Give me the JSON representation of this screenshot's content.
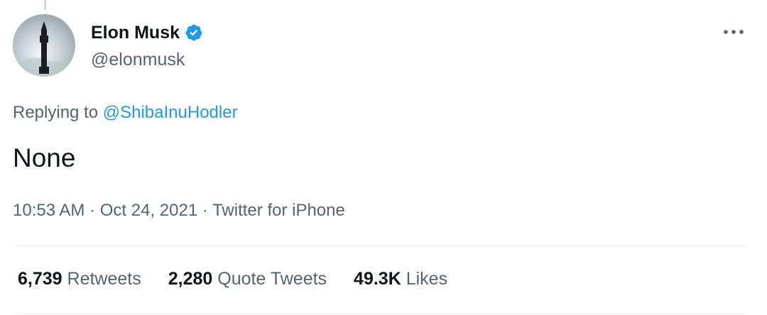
{
  "author": {
    "display_name": "Elon Musk",
    "handle": "@elonmusk",
    "verified": true,
    "verified_color": "#1d9bf0"
  },
  "reply": {
    "prefix": "Replying to",
    "mention": "@ShibaInuHodler"
  },
  "tweet": {
    "text": "None"
  },
  "meta": {
    "time": "10:53 AM",
    "separator1": "·",
    "date": "Oct 24, 2021",
    "separator2": "·",
    "source": "Twitter for iPhone"
  },
  "stats": {
    "retweets": {
      "count": "6,739",
      "label": "Retweets"
    },
    "quotes": {
      "count": "2,280",
      "label": "Quote Tweets"
    },
    "likes": {
      "count": "49.3K",
      "label": "Likes"
    }
  },
  "icons": {
    "avatar": "avatar-image",
    "verified": "verified-badge-icon",
    "more": "more-options-icon"
  },
  "colors": {
    "text_primary": "#0f1419",
    "text_secondary": "#536471",
    "link": "#1d9bf0",
    "divider": "#eff3f4"
  }
}
